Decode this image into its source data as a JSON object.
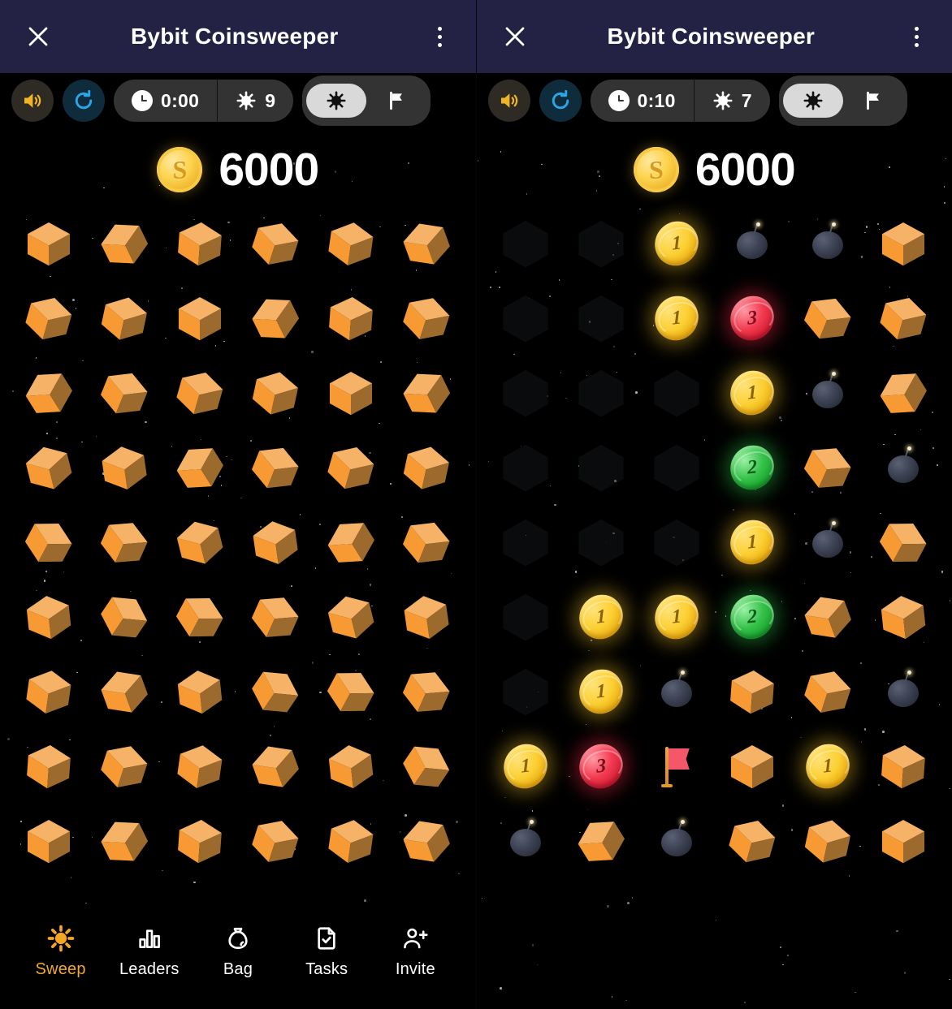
{
  "app": {
    "title": "Bybit Coinsweeper",
    "close_label": "×",
    "menu_label": "More options"
  },
  "theme": {
    "titlebar_bg": "#232244",
    "accent": "#f0a930",
    "coin_gold": "#fcd033",
    "coin_green": "#2fbd45",
    "coin_red": "#ef3750",
    "cube_light": "#f6b266",
    "cube_mid": "#f79a33",
    "cube_dark": "#9d6a2d",
    "pill_bg": "#333333",
    "pill_active_bg": "#d9d9d9"
  },
  "panels": [
    {
      "id": "before",
      "toolbar": {
        "sound_icon": "speaker-icon",
        "refresh_icon": "refresh-icon",
        "timer_icon": "clock-icon",
        "timer_value": "0:00",
        "mine_icon": "mine-icon",
        "mine_count": "9",
        "mode_dig_icon": "mine-icon",
        "mode_flag_icon": "flag-icon",
        "mode_selected": "dig"
      },
      "score": {
        "coin_symbol": "S",
        "value": "6000"
      },
      "grid": {
        "rows": 9,
        "cols": 6,
        "cells": [
          [
            "cube",
            "cube",
            "cube",
            "cube",
            "cube",
            "cube"
          ],
          [
            "cube",
            "cube",
            "cube",
            "cube",
            "cube",
            "cube"
          ],
          [
            "cube",
            "cube",
            "cube",
            "cube",
            "cube",
            "cube"
          ],
          [
            "cube",
            "cube",
            "cube",
            "cube",
            "cube",
            "cube"
          ],
          [
            "cube",
            "cube",
            "cube",
            "cube",
            "cube",
            "cube"
          ],
          [
            "cube",
            "cube",
            "cube",
            "cube",
            "cube",
            "cube"
          ],
          [
            "cube",
            "cube",
            "cube",
            "cube",
            "cube",
            "cube"
          ],
          [
            "cube",
            "cube",
            "cube",
            "cube",
            "cube",
            "cube"
          ],
          [
            "cube",
            "cube",
            "cube",
            "cube",
            "cube",
            "cube"
          ]
        ]
      },
      "bottom_nav": {
        "items": [
          {
            "label": "Sweep",
            "icon": "sun-icon",
            "active": true
          },
          {
            "label": "Leaders",
            "icon": "chart-icon",
            "active": false
          },
          {
            "label": "Bag",
            "icon": "bag-icon",
            "active": false
          },
          {
            "label": "Tasks",
            "icon": "task-icon",
            "active": false
          },
          {
            "label": "Invite",
            "icon": "add-user-icon",
            "active": false
          }
        ]
      }
    },
    {
      "id": "after",
      "toolbar": {
        "sound_icon": "speaker-icon",
        "refresh_icon": "refresh-icon",
        "timer_icon": "clock-icon",
        "timer_value": "0:10",
        "mine_icon": "mine-icon",
        "mine_count": "7",
        "mode_dig_icon": "mine-icon",
        "mode_flag_icon": "flag-icon",
        "mode_selected": "dig"
      },
      "score": {
        "coin_symbol": "S",
        "value": "6000"
      },
      "grid": {
        "rows": 9,
        "cols": 6,
        "cells": [
          [
            "empty",
            "empty",
            "gold-1",
            "bomb",
            "bomb",
            "cube"
          ],
          [
            "empty",
            "empty",
            "gold-1",
            "red-3",
            "cube",
            "cube"
          ],
          [
            "empty",
            "empty",
            "empty",
            "gold-1",
            "bomb",
            "cube"
          ],
          [
            "empty",
            "empty",
            "empty",
            "green-2",
            "cube",
            "bomb"
          ],
          [
            "empty",
            "empty",
            "empty",
            "gold-1",
            "bomb",
            "cube"
          ],
          [
            "empty",
            "gold-1",
            "gold-1",
            "green-2",
            "cube",
            "cube"
          ],
          [
            "empty",
            "gold-1",
            "bomb",
            "cube",
            "cube",
            "bomb"
          ],
          [
            "gold-1",
            "red-3",
            "flag",
            "cube",
            "gold-1",
            "cube"
          ],
          [
            "bomb",
            "cube",
            "bomb",
            "cube",
            "cube",
            "cube"
          ]
        ]
      },
      "bottom_nav": null
    }
  ]
}
